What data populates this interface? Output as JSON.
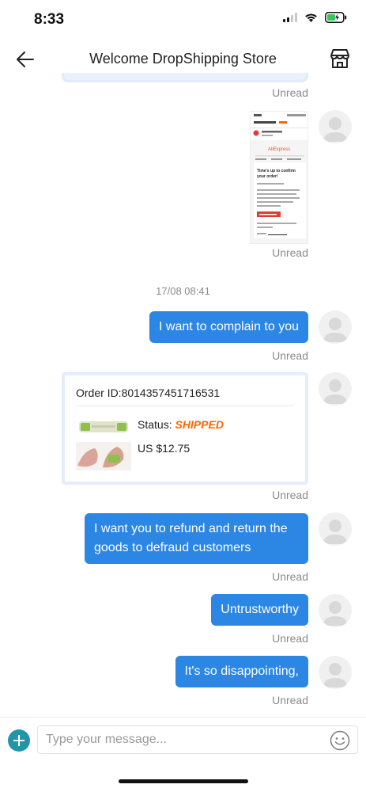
{
  "status_bar": {
    "time": "8:33"
  },
  "header": {
    "title": "Welcome DropShipping Store"
  },
  "messages": {
    "unread_1": "Unread",
    "unread_2": "Unread",
    "timestamp": "17/08 08:41",
    "complain_text": "I want to complain to you",
    "unread_3": "Unread",
    "order_card": {
      "order_id": "Order ID:8014357451716531",
      "status_label": "Status:",
      "status_value": "SHIPPED",
      "price": "US $12.75"
    },
    "unread_4": "Unread",
    "refund_text": "I want you to refund and return the goods to defraud customers",
    "unread_5": "Unread",
    "untrust_text": "Untrustworthy",
    "unread_6": "Unread",
    "disappoint_text": "It's so disappointing,",
    "unread_7": "Unread"
  },
  "screenshot_preview": {
    "brand": "AliExpress",
    "heading": "Time's up to confirm your order!",
    "button": "Buy order details"
  },
  "input": {
    "placeholder": "Type your message..."
  },
  "colors": {
    "bubble": "#2b86e4",
    "status_shipped": "#ff6600",
    "plus": "#2096a8"
  }
}
